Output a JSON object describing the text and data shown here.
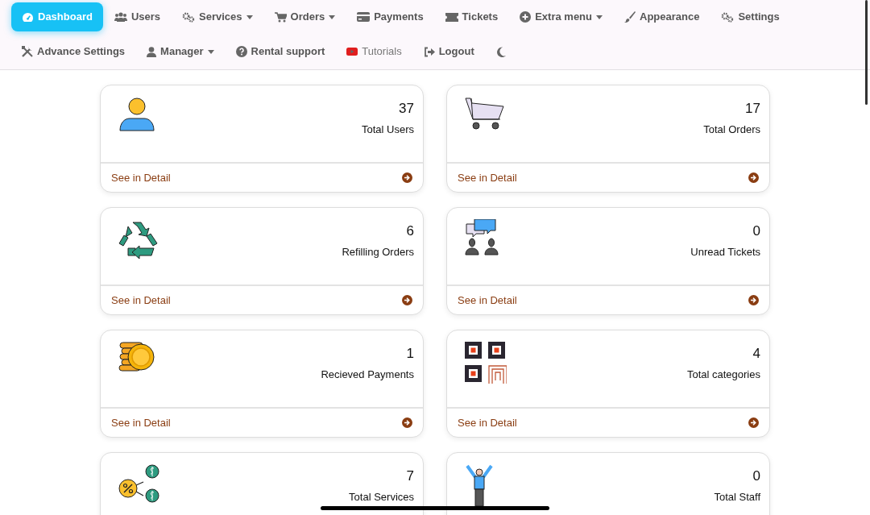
{
  "nav": {
    "top_row": [
      {
        "label": "Dashboard",
        "selected": true,
        "dropdown": false
      },
      {
        "label": "Users",
        "selected": false,
        "dropdown": false
      },
      {
        "label": "Services",
        "selected": false,
        "dropdown": true
      },
      {
        "label": "Orders",
        "selected": false,
        "dropdown": true
      },
      {
        "label": "Payments",
        "selected": false,
        "dropdown": false
      },
      {
        "label": "Tickets",
        "selected": false,
        "dropdown": false
      },
      {
        "label": "Extra menu",
        "selected": false,
        "dropdown": true
      },
      {
        "label": "Appearance",
        "selected": false,
        "dropdown": false
      },
      {
        "label": "Settings",
        "selected": false,
        "dropdown": false
      }
    ],
    "bottom_row": [
      {
        "label": "Advance Settings",
        "selected": false,
        "dropdown": false
      },
      {
        "label": "Manager",
        "selected": false,
        "dropdown": true
      },
      {
        "label": "Rental support",
        "selected": false,
        "dropdown": false
      },
      {
        "label": "Tutorials",
        "selected": false,
        "dropdown": false
      },
      {
        "label": "Logout",
        "selected": false,
        "dropdown": false
      },
      {
        "selected": false,
        "dropdown": false
      }
    ]
  },
  "cards": [
    {
      "value": "37",
      "label": "Total Users",
      "link": "See in Detail"
    },
    {
      "value": "17",
      "label": "Total Orders",
      "link": "See in Detail"
    },
    {
      "value": "6",
      "label": "Refilling Orders",
      "link": "See in Detail"
    },
    {
      "value": "0",
      "label": "Unread Tickets",
      "link": "See in Detail"
    },
    {
      "value": "1",
      "label": "Recieved Payments",
      "link": "See in Detail"
    },
    {
      "value": "4",
      "label": "Total categories",
      "link": "See in Detail"
    },
    {
      "value": "7",
      "label": "Total Services"
    },
    {
      "value": "0",
      "label": "Total Staff"
    }
  ]
}
